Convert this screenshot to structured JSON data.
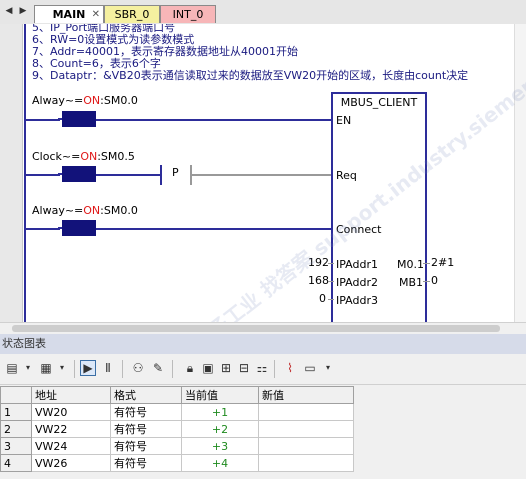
{
  "tabs": [
    {
      "label": "MAIN",
      "active": true,
      "closable": true
    },
    {
      "label": "SBR_0",
      "color": "#f5f0a0"
    },
    {
      "label": "INT_0",
      "color": "#f7b6b8"
    }
  ],
  "comments": [
    "5、IP_Port端口服务器端口号",
    "6、RW=0设置模式为读参数模式",
    "7、Addr=40001，表示寄存器数据地址从40001开始",
    "8、Count=6，表示6个字",
    "9、Dataptr：&VB20表示通信读取过来的数据放至VW20开始的区域，长度由count决定"
  ],
  "contacts": [
    {
      "label_pre": "Alway~=",
      "label_on": "ON",
      "label_post": ":SM0.0"
    },
    {
      "label_pre": "Clock~=",
      "label_on": "ON",
      "label_post": ":SM0.5"
    },
    {
      "label_pre": "Alway~=",
      "label_on": "ON",
      "label_post": ":SM0.0"
    }
  ],
  "p_coil": "P",
  "function_block": {
    "title": "MBUS_CLIENT",
    "inputs": [
      {
        "name": "EN",
        "value": ""
      },
      {
        "name": "Req",
        "value": ""
      },
      {
        "name": "Connect",
        "value": ""
      },
      {
        "name": "IPAddr1",
        "value": "192"
      },
      {
        "name": "IPAddr2",
        "value": "168"
      },
      {
        "name": "IPAddr3",
        "value": "0"
      }
    ],
    "outputs": [
      {
        "name": "M0.1",
        "value": "2#1"
      },
      {
        "name": "MB1",
        "value": "0"
      }
    ]
  },
  "status_panel": {
    "title": "状态图表",
    "columns": [
      "地址",
      "格式",
      "当前值",
      "新值"
    ],
    "rows": [
      {
        "num": "1",
        "address": "VW20",
        "format": "有符号",
        "current": "+1",
        "new": ""
      },
      {
        "num": "2",
        "address": "VW22",
        "format": "有符号",
        "current": "+2",
        "new": ""
      },
      {
        "num": "3",
        "address": "VW24",
        "format": "有符号",
        "current": "+3",
        "new": ""
      },
      {
        "num": "4",
        "address": "VW26",
        "format": "有符号",
        "current": "+4",
        "new": ""
      }
    ]
  },
  "watermark": "西门子工业 找答案 support.industry.siemens.com/cs",
  "colors": {
    "power_rail": "#2d2d9a",
    "on_text": "#e01818",
    "current_value": "#1f8a1f"
  }
}
